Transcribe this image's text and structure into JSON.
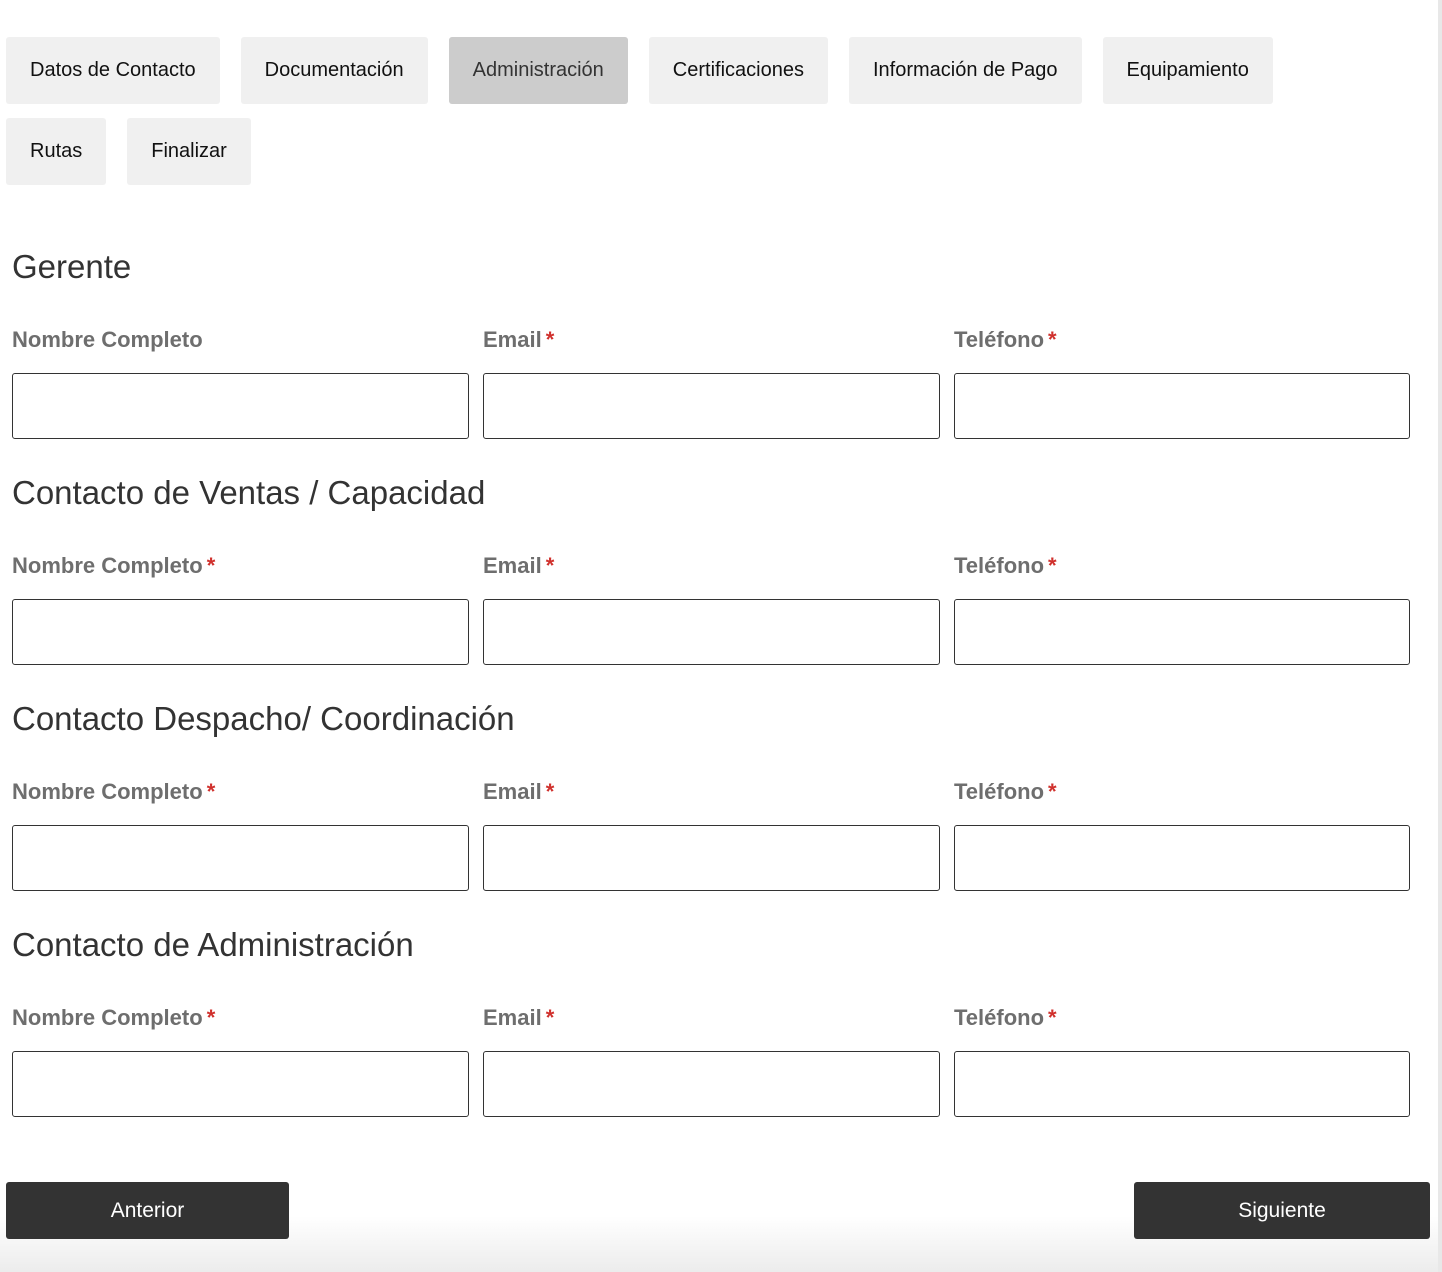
{
  "tabs": [
    {
      "label": "Datos de Contacto",
      "active": false
    },
    {
      "label": "Documentación",
      "active": false
    },
    {
      "label": "Administración",
      "active": true
    },
    {
      "label": "Certificaciones",
      "active": false
    },
    {
      "label": "Información de Pago",
      "active": false
    },
    {
      "label": "Equipamiento",
      "active": false
    },
    {
      "label": "Rutas",
      "active": false
    },
    {
      "label": "Finalizar",
      "active": false
    }
  ],
  "sections": [
    {
      "title": "Gerente",
      "fields": [
        {
          "label": "Nombre Completo",
          "required": false,
          "value": ""
        },
        {
          "label": "Email",
          "required": true,
          "value": ""
        },
        {
          "label": "Teléfono",
          "required": true,
          "value": ""
        }
      ]
    },
    {
      "title": "Contacto de Ventas / Capacidad",
      "fields": [
        {
          "label": "Nombre Completo",
          "required": true,
          "value": ""
        },
        {
          "label": "Email",
          "required": true,
          "value": ""
        },
        {
          "label": "Teléfono",
          "required": true,
          "value": ""
        }
      ]
    },
    {
      "title": "Contacto Despacho/ Coordinación",
      "fields": [
        {
          "label": "Nombre Completo",
          "required": true,
          "value": ""
        },
        {
          "label": "Email",
          "required": true,
          "value": ""
        },
        {
          "label": "Teléfono",
          "required": true,
          "value": ""
        }
      ]
    },
    {
      "title": "Contacto de Administración",
      "fields": [
        {
          "label": "Nombre Completo",
          "required": true,
          "value": ""
        },
        {
          "label": "Email",
          "required": true,
          "value": ""
        },
        {
          "label": "Teléfono",
          "required": true,
          "value": ""
        }
      ]
    }
  ],
  "required_marker": "*",
  "nav": {
    "prev_label": "Anterior",
    "next_label": "Siguiente"
  },
  "colors": {
    "tab_bg": "#f0f0f0",
    "tab_active_bg": "#cccccc",
    "button_bg": "#333333",
    "required": "#d0312d",
    "label": "#6e6e6e"
  }
}
